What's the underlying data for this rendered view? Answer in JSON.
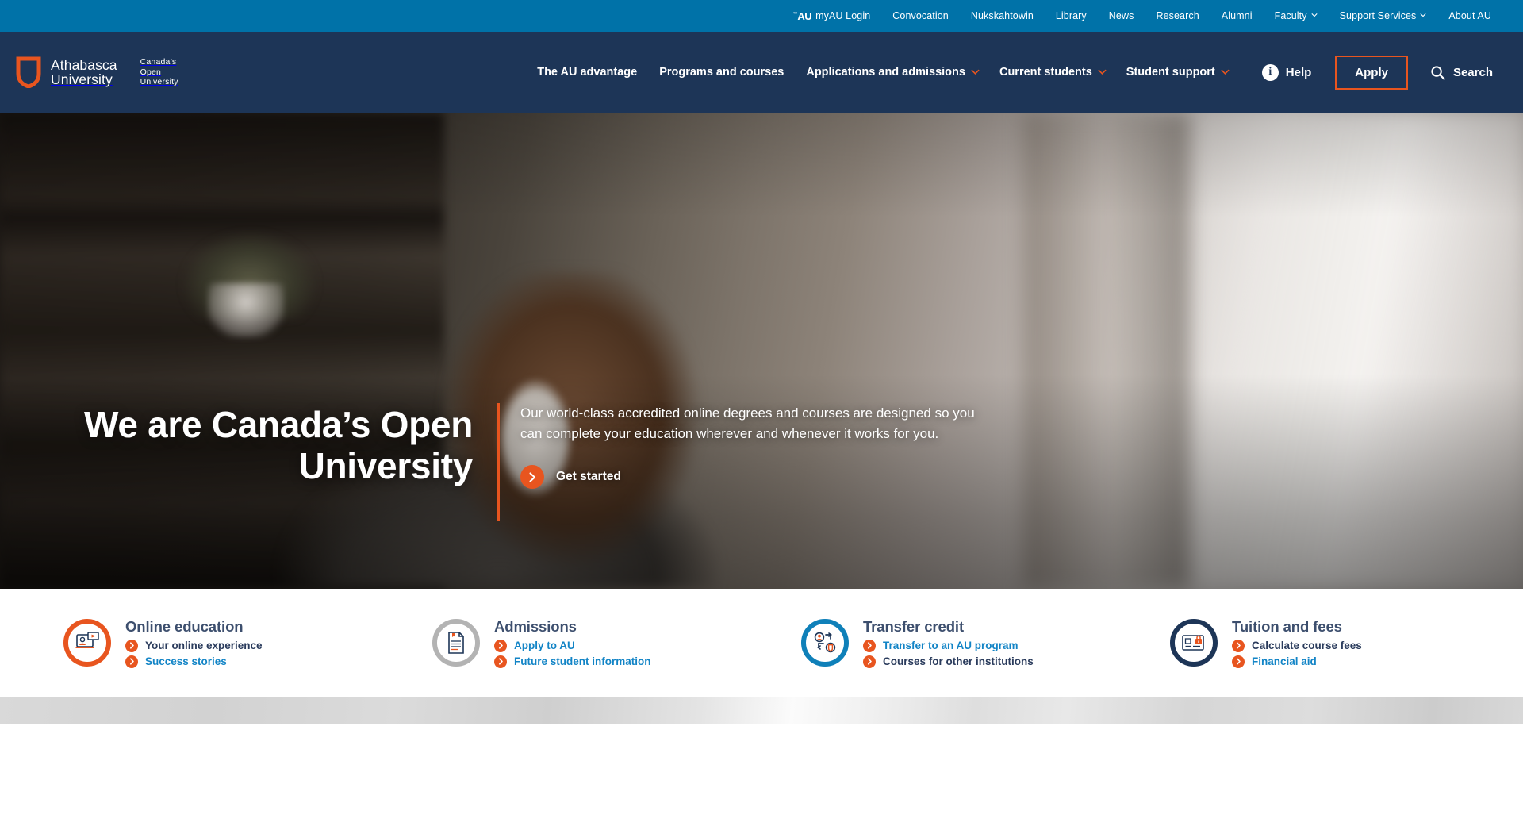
{
  "colors": {
    "utility_bar": "#0072a8",
    "nav_bar": "#1d3557",
    "accent_orange": "#e8551f",
    "link_blue": "#1284c6",
    "title_navy": "#3d4f6e",
    "ring_gray": "#b3b3b3",
    "ring_blue": "#0f80b9",
    "ring_navy": "#1d3557"
  },
  "utility_bar": {
    "items": [
      {
        "label": "myAU Login",
        "icon": "au-mark-icon",
        "caret": false
      },
      {
        "label": "Convocation",
        "caret": false
      },
      {
        "label": "Nukskahtowin",
        "caret": false
      },
      {
        "label": "Library",
        "caret": false
      },
      {
        "label": "News",
        "caret": false
      },
      {
        "label": "Research",
        "caret": false
      },
      {
        "label": "Alumni",
        "caret": false
      },
      {
        "label": "Faculty",
        "caret": true
      },
      {
        "label": "Support Services",
        "caret": true
      },
      {
        "label": "About AU",
        "caret": false
      }
    ]
  },
  "logo": {
    "icon": "shield-icon",
    "name_line1": "Athabasca",
    "name_line2": "University",
    "tagline_line1": "Canada’s",
    "tagline_line2": "Open",
    "tagline_line3": "University"
  },
  "main_nav": {
    "items": [
      {
        "label": "The AU advantage",
        "caret": false
      },
      {
        "label": "Programs and courses",
        "caret": false
      },
      {
        "label": "Applications and admissions",
        "caret": true
      },
      {
        "label": "Current students",
        "caret": true
      },
      {
        "label": "Student support",
        "caret": true
      }
    ],
    "help_label": "Help",
    "help_icon": "info-circle-icon",
    "apply_label": "Apply",
    "search_label": "Search",
    "search_icon": "search-icon"
  },
  "hero": {
    "heading": "We are Canada’s Open University",
    "paragraph": "Our world-class accredited online degrees and courses are designed so you can complete your education wherever and whenever it works for you.",
    "cta_label": "Get started",
    "cta_icon": "chevron-right-icon"
  },
  "cards": [
    {
      "title": "Online education",
      "icon": "laptop-video-icon",
      "ring": "orange",
      "links": [
        {
          "label": "Your online experience",
          "style": "navy"
        },
        {
          "label": "Success stories",
          "style": "blue"
        }
      ]
    },
    {
      "title": "Admissions",
      "icon": "document-icon",
      "ring": "gray",
      "links": [
        {
          "label": "Apply to AU",
          "style": "blue"
        },
        {
          "label": "Future student information",
          "style": "blue"
        }
      ]
    },
    {
      "title": "Transfer credit",
      "icon": "transfer-icon",
      "ring": "blue",
      "links": [
        {
          "label": "Transfer to an AU program",
          "style": "blue"
        },
        {
          "label": "Courses for other institutions",
          "style": "navy"
        }
      ]
    },
    {
      "title": "Tuition and fees",
      "icon": "id-card-lock-icon",
      "ring": "navy",
      "links": [
        {
          "label": "Calculate course fees",
          "style": "navy"
        },
        {
          "label": "Financial aid",
          "style": "blue"
        }
      ]
    }
  ]
}
